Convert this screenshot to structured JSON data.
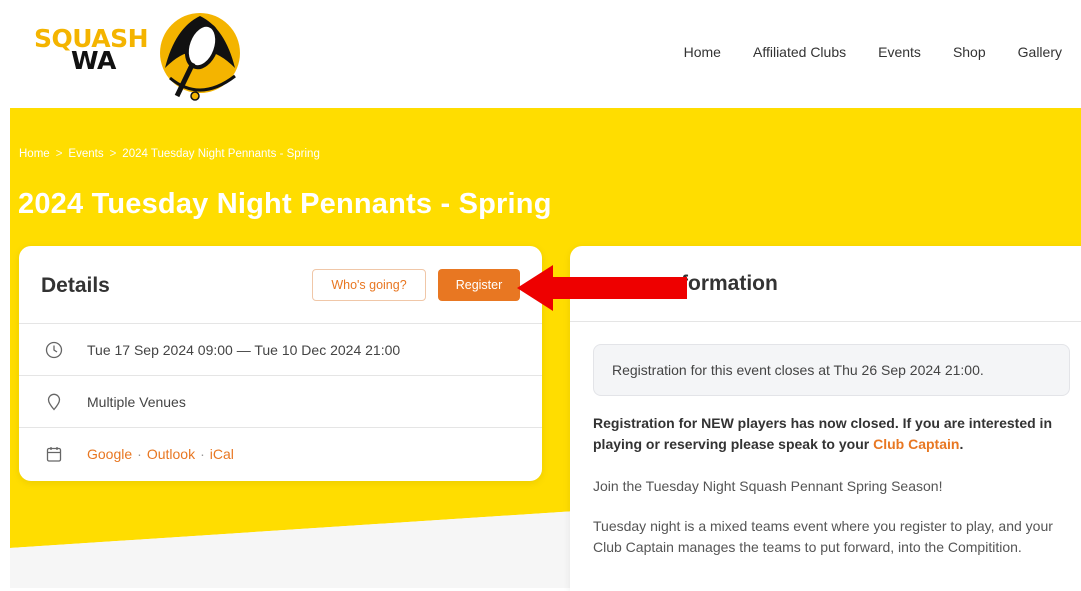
{
  "brand": {
    "line1": "SQUASH",
    "line2": "WA"
  },
  "nav": {
    "items": [
      "Home",
      "Affiliated Clubs",
      "Events",
      "Shop",
      "Gallery"
    ]
  },
  "breadcrumb": {
    "home": "Home",
    "sep": ">",
    "events": "Events",
    "current": "2024 Tuesday Night Pennants - Spring"
  },
  "page": {
    "title": "2024 Tuesday Night Pennants - Spring"
  },
  "details": {
    "title": "Details",
    "whos_going_label": "Who's going?",
    "register_label": "Register",
    "dates": "Tue 17 Sep 2024 09:00 — Tue 10 Dec 2024 21:00",
    "venue": "Multiple Venues",
    "calendar": {
      "google": "Google",
      "outlook": "Outlook",
      "ical": "iCal",
      "sep": "·"
    }
  },
  "info": {
    "title": "formation",
    "notice": "Registration for this event closes at Thu 26 Sep 2024 21:00.",
    "para1_prefix": "Registration for NEW players has now closed.  If you are interested in playing or reserving please speak to your ",
    "para1_link": "Club Captain",
    "para1_suffix": ".",
    "para2": "Join the Tuesday Night Squash Pennant Spring Season!",
    "para3": "Tuesday night is a mixed teams event where you register to play, and your Club Captain manages the teams to put forward, into the Compitition."
  },
  "colors": {
    "accent": "#e87722",
    "hero_yellow": "#ffdd00",
    "arrow_red": "#ee0000"
  }
}
